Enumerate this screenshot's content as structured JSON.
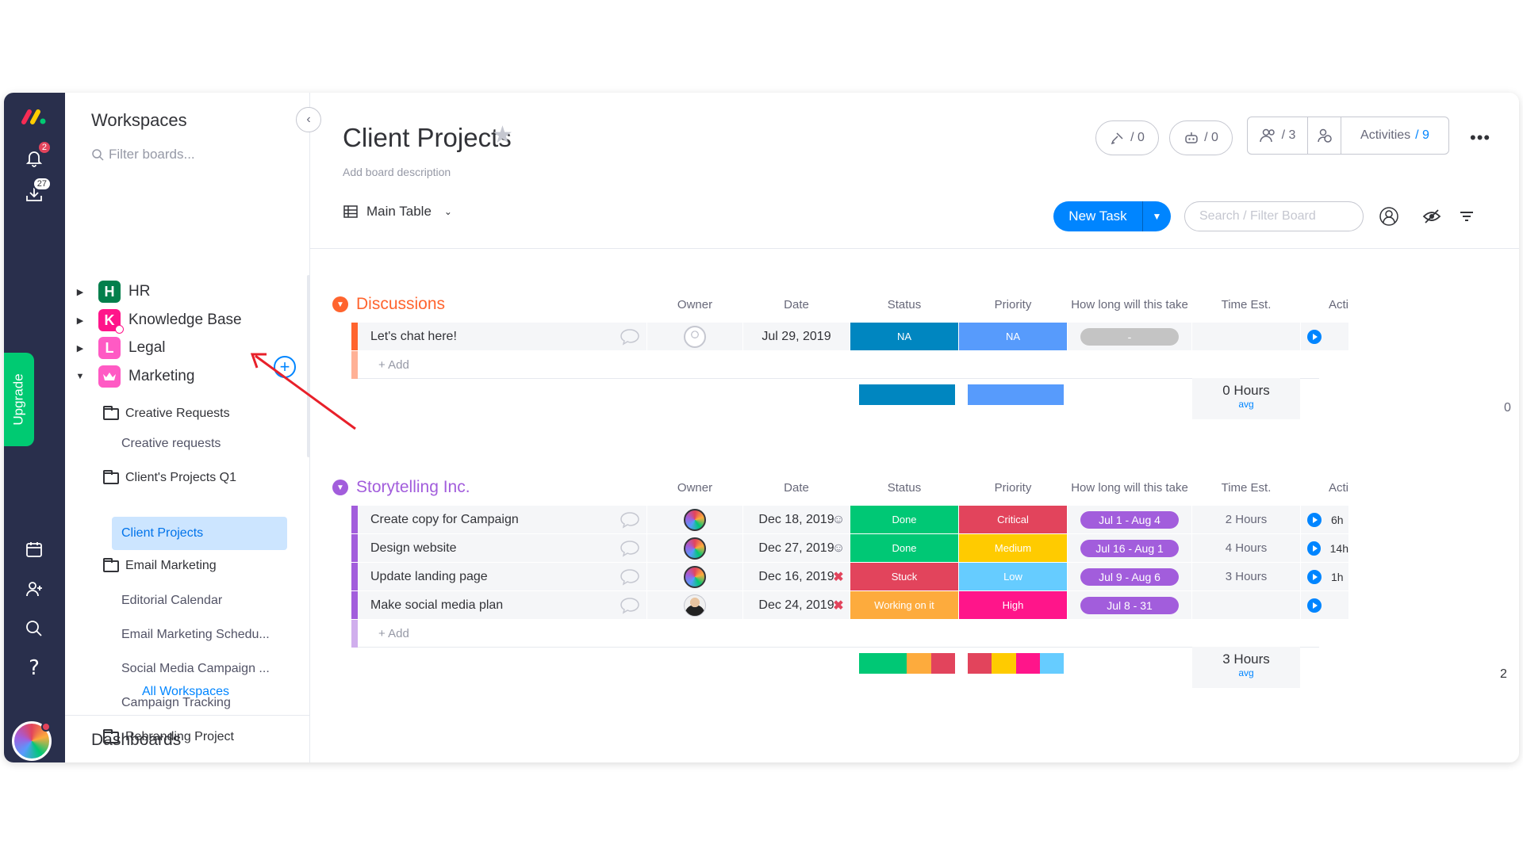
{
  "sidebar": {
    "title": "Workspaces",
    "filter_placeholder": "Filter boards...",
    "workspaces": [
      {
        "letter": "H",
        "label": "HR",
        "color": "#037f4c"
      },
      {
        "letter": "K",
        "label": "Knowledge Base",
        "color": "#ff158a"
      },
      {
        "letter": "L",
        "label": "Legal",
        "color": "#ff5ac4"
      },
      {
        "letter": "",
        "label": "Marketing",
        "color": "#ff5ac4"
      }
    ],
    "tree": [
      {
        "label": "Creative Requests",
        "type": "folder"
      },
      {
        "label": "Creative requests",
        "type": "board"
      },
      {
        "label": "Client's Projects Q1",
        "type": "folder"
      },
      {
        "label": "Client Projects",
        "type": "board",
        "active": true
      },
      {
        "label": "Email Marketing",
        "type": "folder"
      },
      {
        "label": "Editorial Calendar",
        "type": "board"
      },
      {
        "label": "Email Marketing Schedu...",
        "type": "board"
      },
      {
        "label": "Social Media Campaign ...",
        "type": "board"
      },
      {
        "label": "Campaign Tracking",
        "type": "board"
      },
      {
        "label": "Rebranding Project",
        "type": "folder"
      }
    ],
    "all_workspaces": "All Workspaces",
    "dashboards": "Dashboards"
  },
  "rail": {
    "notifications_badge": "2",
    "inbox_badge": "27",
    "upgrade": "Upgrade"
  },
  "board": {
    "title": "Client Projects",
    "description": "Add board description",
    "integrations_count": "/ 0",
    "automations_count": "/ 0",
    "members_count": "/ 3",
    "activities_label": "Activities",
    "activities_count": "/ 9",
    "view_label": "Main Table",
    "new_task": "New Task",
    "search_placeholder": "Search / Filter Board"
  },
  "columns": [
    "Owner",
    "Date",
    "Status",
    "Priority",
    "How long will this take",
    "Time Est.",
    "Acti"
  ],
  "groups": [
    {
      "title": "Discussions",
      "color": "#ff642e",
      "rows": [
        {
          "name": "Let's chat here!",
          "owner": "empty",
          "date": "Jul 29, 2019",
          "flag": "",
          "status": "NA",
          "status_color": "#0086c0",
          "priority": "NA",
          "priority_color": "#579bfc",
          "timeline": "-",
          "timeline_color": "#c4c4c4",
          "est": "",
          "act": ""
        }
      ],
      "add_label": "+ Add",
      "summary_est": "0 Hours",
      "summary_label": "avg",
      "summary_extra": "0"
    },
    {
      "title": "Storytelling Inc.",
      "color": "#a25ddc",
      "rows": [
        {
          "name": "Create copy for Campaign",
          "owner": "rainbow",
          "date": "Dec 18, 2019",
          "flag": "smile",
          "status": "Done",
          "status_color": "#00c875",
          "priority": "Critical",
          "priority_color": "#e2445c",
          "timeline": "Jul 1 - Aug 4",
          "timeline_color": "#a25ddc",
          "est": "2 Hours",
          "act": "6h"
        },
        {
          "name": "Design website",
          "owner": "rainbow",
          "date": "Dec 27, 2019",
          "flag": "smile",
          "status": "Done",
          "status_color": "#00c875",
          "priority": "Medium",
          "priority_color": "#ffcb00",
          "timeline": "Jul 16 - Aug 1",
          "timeline_color": "#a25ddc",
          "est": "4 Hours",
          "act": "14h"
        },
        {
          "name": "Update landing page",
          "owner": "rainbow",
          "date": "Dec 16, 2019",
          "flag": "x",
          "status": "Stuck",
          "status_color": "#e2445c",
          "priority": "Low",
          "priority_color": "#66ccff",
          "timeline": "Jul 9 - Aug 6",
          "timeline_color": "#a25ddc",
          "est": "3 Hours",
          "act": "1h"
        },
        {
          "name": "Make social media plan",
          "owner": "man",
          "date": "Dec 24, 2019",
          "flag": "x",
          "status": "Working on it",
          "status_color": "#fdab3d",
          "priority": "High",
          "priority_color": "#ff158a",
          "timeline": "Jul 8 - 31",
          "timeline_color": "#a25ddc",
          "est": "",
          "act": ""
        }
      ],
      "add_label": "+ Add",
      "summary_est": "3 Hours",
      "summary_label": "avg",
      "summary_extra": "2"
    }
  ]
}
